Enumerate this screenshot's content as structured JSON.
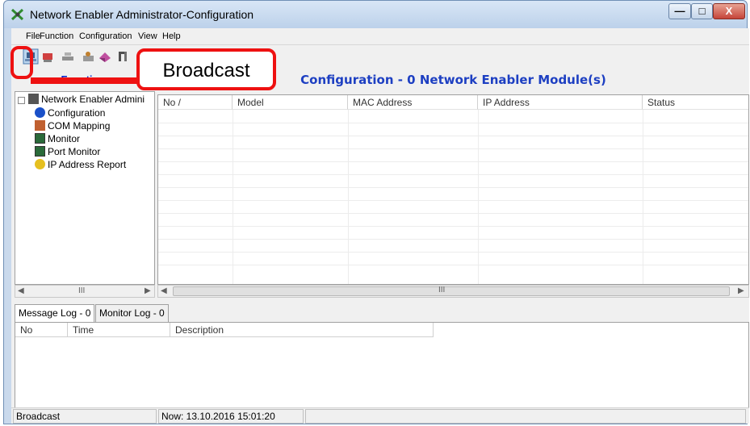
{
  "window": {
    "title": "Network Enabler Administrator-Configuration",
    "minimize_glyph": "—",
    "maximize_glyph": "□",
    "close_glyph": "X",
    "close_color": "#c5443a"
  },
  "menubar": {
    "items": [
      "File",
      "Function",
      "Configuration",
      "View",
      "Help"
    ]
  },
  "toolbar": {
    "icons": [
      "broadcast-icon",
      "search-icon",
      "network-icon",
      "unlock-icon",
      "export-icon",
      "settings-icon"
    ]
  },
  "function_panel": {
    "header": "Function",
    "tree": {
      "root": "Network Enabler Admini",
      "children": [
        "Configuration",
        "COM Mapping",
        "Monitor",
        "Port Monitor",
        "IP Address Report"
      ]
    },
    "scroll_thumb": "III"
  },
  "config_panel": {
    "header": "Configuration - 0 Network Enabler Module(s)",
    "columns": [
      "No  /",
      "Model",
      "MAC Address",
      "IP Address",
      "Status"
    ],
    "rows": [],
    "scroll_thumb": "III"
  },
  "log_panel": {
    "tabs": [
      "Message Log - 0",
      "Monitor Log - 0"
    ],
    "columns": [
      "No",
      "Time",
      "Description"
    ]
  },
  "statusbar": {
    "left": "Broadcast",
    "time": "Now: 13.10.2016 15:01:20"
  },
  "annotation": {
    "label": "Broadcast",
    "color": "#ee1111"
  }
}
